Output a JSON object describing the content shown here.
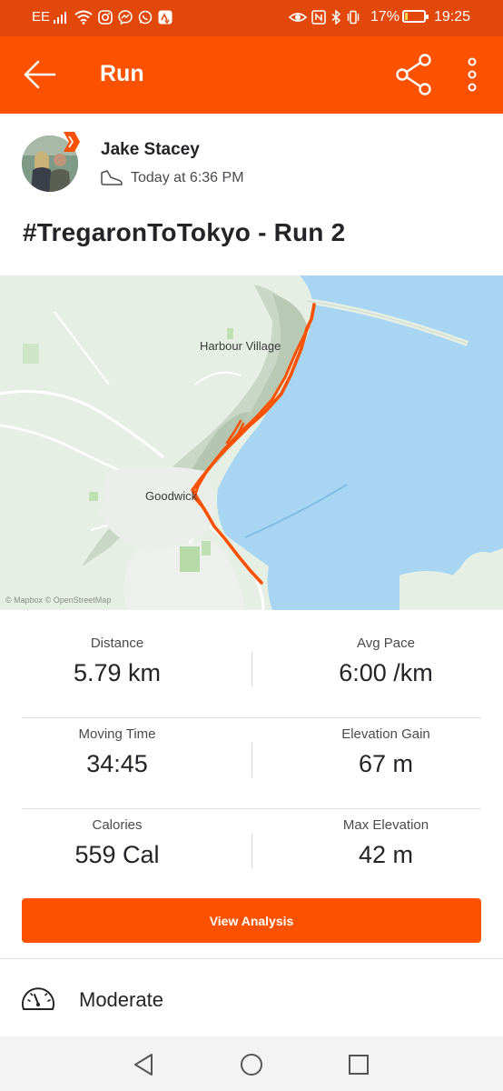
{
  "status_bar": {
    "carrier": "EE",
    "battery_percent": "17%",
    "battery_level": 0.17,
    "time": "19:25"
  },
  "app_bar": {
    "title": "Run",
    "icons": [
      "back-arrow-icon",
      "share-icon",
      "more-vertical-icon"
    ]
  },
  "athlete": {
    "name": "Jake Stacey",
    "timestamp": "Today at 6:36 PM",
    "activity_icon": "shoe-icon"
  },
  "activity": {
    "title": "#TregaronToTokyo - Run 2"
  },
  "map": {
    "labels": {
      "harbour_village": "Harbour Village",
      "goodwick": "Goodwick"
    },
    "attribution": "© Mapbox © OpenStreetMap",
    "route_color": "#fc5200",
    "water_color": "#a8d5f2"
  },
  "stats": {
    "distance": {
      "label": "Distance",
      "value": "5.79 km"
    },
    "avg_pace": {
      "label": "Avg Pace",
      "value": "6:00 /km"
    },
    "moving_time": {
      "label": "Moving Time",
      "value": "34:45"
    },
    "elevation_gain": {
      "label": "Elevation Gain",
      "value": "67 m"
    },
    "calories": {
      "label": "Calories",
      "value": "559 Cal"
    },
    "max_elevation": {
      "label": "Max Elevation",
      "value": "42 m"
    }
  },
  "actions": {
    "view_analysis": "View Analysis"
  },
  "effort": {
    "label": "Moderate",
    "icon": "gauge-icon"
  },
  "colors": {
    "brand": "#fc5200",
    "status_bar": "#e2480a"
  }
}
